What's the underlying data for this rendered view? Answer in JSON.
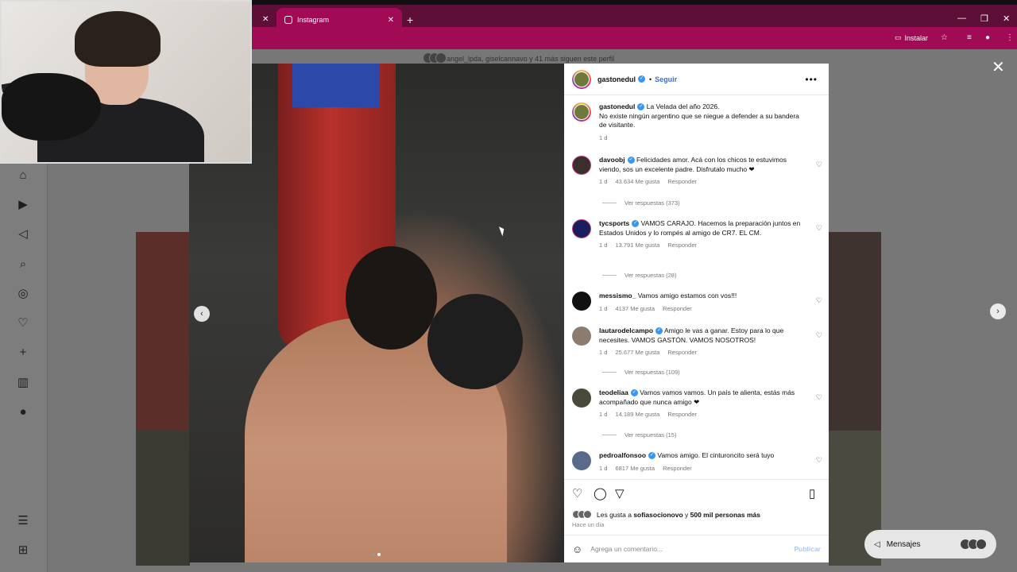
{
  "browser": {
    "tab_title": "Instagram",
    "install_label": "Instalar"
  },
  "profile_header": {
    "followers_text": "angel_lpda, giselcannavo y 41 más siguen este perfil"
  },
  "post": {
    "author": "gastonedul",
    "follow_label": "Seguir",
    "caption_line1": "La Velada del año 2026.",
    "caption_line2": "No existe ningún argentino que se niegue a defender a su bandera de visitante.",
    "caption_time": "1 d",
    "comments": [
      {
        "user": "davoobj",
        "text": "Felicidades amor. Acá con los chicos te estuvimos viendo, sos un excelente padre. Disfrutalo mucho ❤",
        "time": "1 d",
        "likes": "43.634 Me gusta",
        "reply": "Responder",
        "replies": "Ver respuestas (373)"
      },
      {
        "user": "tycsports",
        "text": "VAMOS CARAJO. Hacemos la preparación juntos en Estados Unidos y lo rompés al amigo de CR7. EL CM.",
        "time": "1 d",
        "likes": "13.791 Me gusta",
        "reply": "Responder",
        "replies": "Ver respuestas (28)"
      },
      {
        "user": "messismo_",
        "text": "Vamos amigo estamos con vos!!!",
        "time": "1 d",
        "likes": "4137 Me gusta",
        "reply": "Responder",
        "replies": ""
      },
      {
        "user": "lautarodelcampo",
        "text": "Amigo le vas a ganar. Estoy para lo que necesites. VAMOS GASTÓN. VAMOS NOSOTROS!",
        "time": "1 d",
        "likes": "25.677 Me gusta",
        "reply": "Responder",
        "replies": "Ver respuestas (109)"
      },
      {
        "user": "teodeliaa",
        "text": "Vamos vamos vamos. Un país te alienta, estás más acompañado que nunca amigo ❤",
        "time": "1 d",
        "likes": "14.189 Me gusta",
        "reply": "Responder",
        "replies": "Ver respuestas (15)"
      },
      {
        "user": "pedroalfonsoo",
        "text": "Vamos amigo. El cinturoncito será tuyo",
        "time": "1 d",
        "likes": "6817 Me gusta",
        "reply": "Responder",
        "replies": ""
      }
    ],
    "likes_prefix": "Les gusta a ",
    "likes_user": "sofiasocionovo",
    "likes_mid": " y ",
    "likes_count": "500 mil personas más",
    "posted_ago": "Hace un día",
    "add_comment_placeholder": "Agrega un comentario...",
    "publish_label": "Publicar"
  },
  "messages_label": "Mensajes"
}
